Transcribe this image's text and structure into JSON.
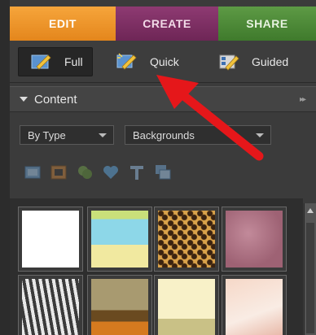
{
  "tabs": [
    {
      "label": "EDIT"
    },
    {
      "label": "CREATE"
    },
    {
      "label": "SHARE"
    }
  ],
  "modes": {
    "full": "Full",
    "quick": "Quick",
    "guided": "Guided"
  },
  "content_panel": {
    "title": "Content",
    "type_dropdown": "By Type",
    "category_dropdown": "Backgrounds"
  },
  "filter_icons": [
    "frame-icon",
    "picture-frame-icon",
    "clipart-icon",
    "heart-icon",
    "text-icon",
    "layered-icon"
  ],
  "thumbnails": [
    "white",
    "scrapbook",
    "leopard",
    "pink-grunge",
    "zebra",
    "autumn",
    "cream",
    "peach"
  ],
  "colors": {
    "edit_tab": "#e4861c",
    "create_tab": "#6e2656",
    "share_tab": "#3f7a2c",
    "annotation_arrow": "#e5171a"
  }
}
